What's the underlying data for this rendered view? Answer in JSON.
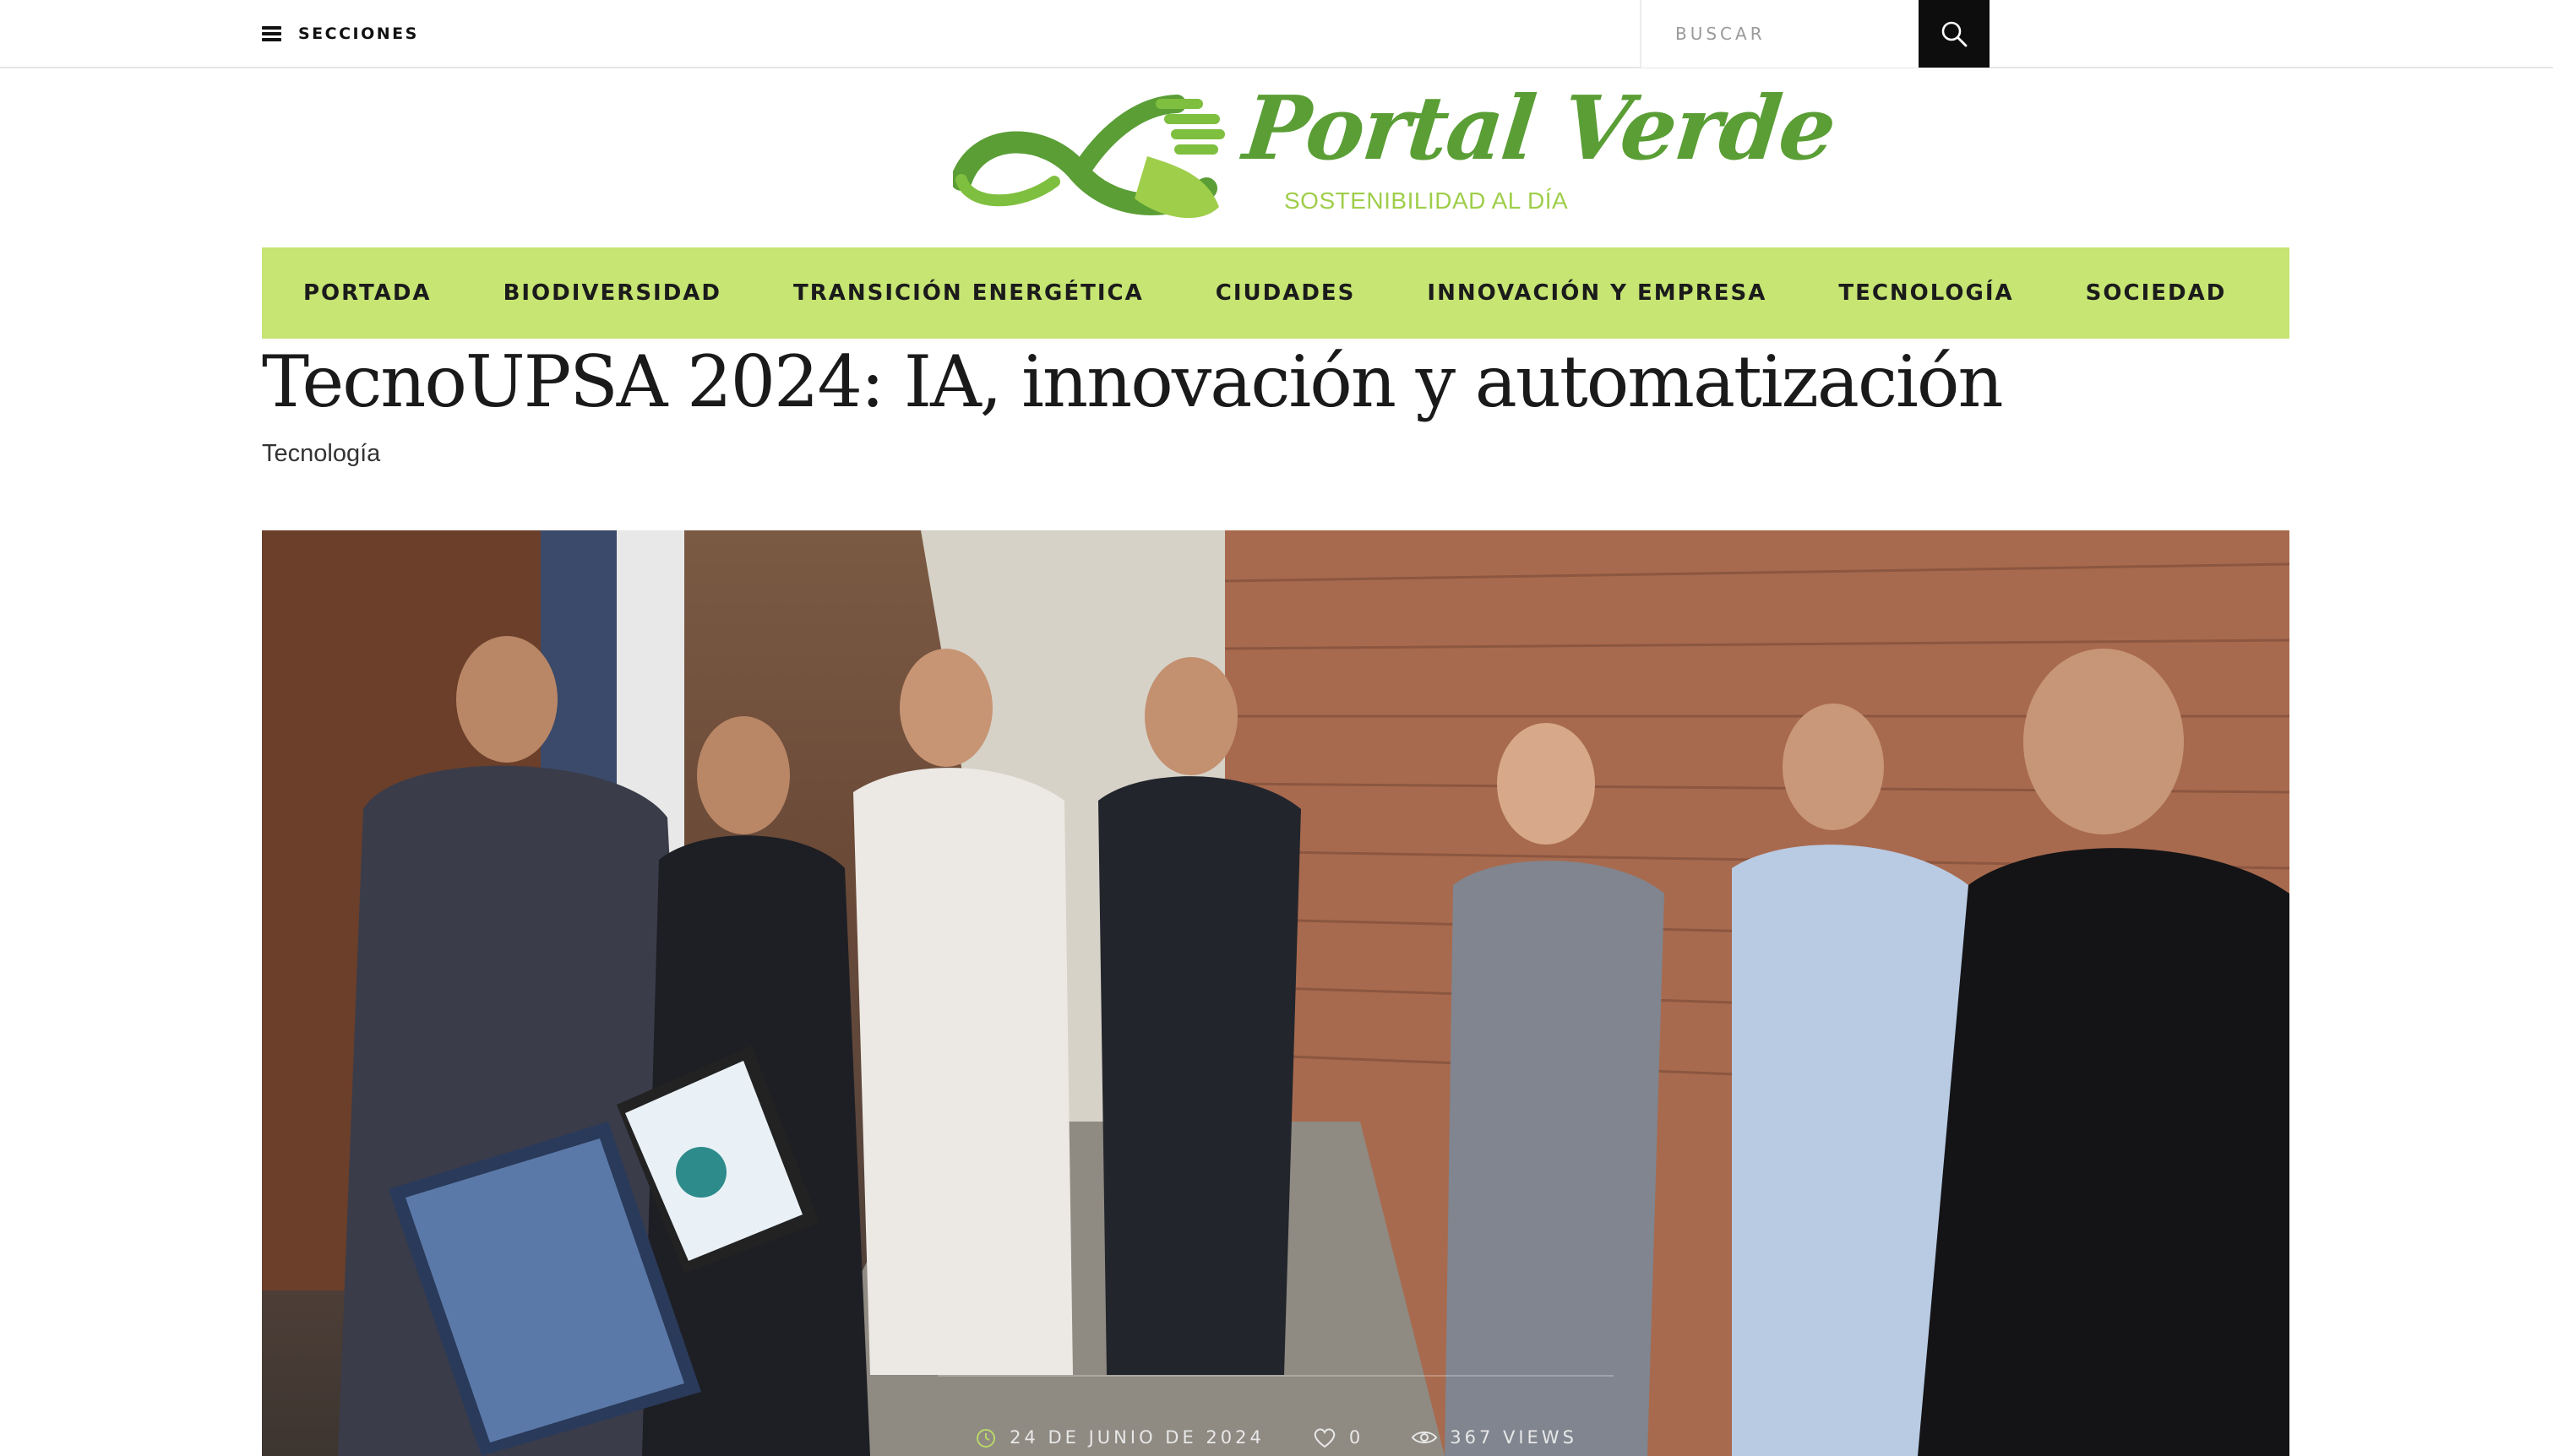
{
  "topbar": {
    "sections_label": "SECCIONES",
    "search_placeholder": "BUSCAR"
  },
  "logo": {
    "name": "Portal Verde",
    "tagline": "SOSTENIBILIDAD AL DÍA",
    "colors": {
      "primary": "#5a9e35",
      "light": "#9fce4a"
    }
  },
  "nav": {
    "items": [
      {
        "label": "PORTADA"
      },
      {
        "label": "BIODIVERSIDAD"
      },
      {
        "label": "TRANSICIÓN ENERGÉTICA"
      },
      {
        "label": "CIUDADES"
      },
      {
        "label": "INNOVACIÓN Y EMPRESA"
      },
      {
        "label": "TECNOLOGÍA"
      },
      {
        "label": "SOCIEDAD"
      }
    ],
    "background": "#c6e573"
  },
  "article": {
    "title": "TecnoUPSA 2024: IA, innovación y automatización",
    "category": "Tecnología",
    "date": "24 DE JUNIO DE 2024",
    "likes": "0",
    "views": "367 VIEWS"
  },
  "icons": {
    "menu": "hamburger-icon",
    "search": "search-icon",
    "date": "clock-icon",
    "likes": "heart-icon",
    "views": "eye-icon"
  }
}
